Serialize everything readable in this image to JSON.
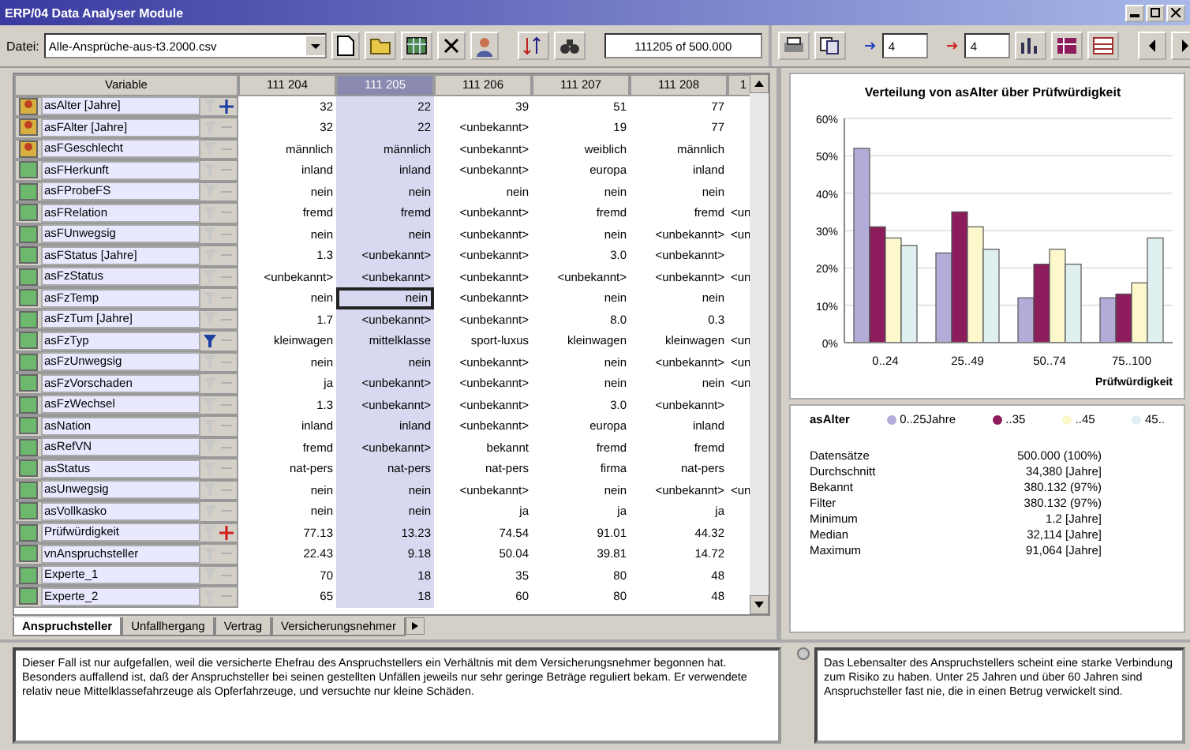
{
  "window": {
    "title": "ERP/04 Data Analyser Module"
  },
  "toolbar": {
    "file_label": "Datei:",
    "file": "Alle-Ansprüche-aus-t3.2000.csv",
    "counter": "111205 of 500.000",
    "blue_spin": "4",
    "red_spin": "4"
  },
  "table": {
    "name_header": "Variable",
    "columns": [
      {
        "label": "111 204",
        "selected": false
      },
      {
        "label": "111 205",
        "selected": true
      },
      {
        "label": "111 206",
        "selected": false
      },
      {
        "label": "111 207",
        "selected": false
      },
      {
        "label": "111 208",
        "selected": false
      },
      {
        "label": "1",
        "selected": false
      }
    ],
    "rows": [
      {
        "name": "asAlter [Jahre]",
        "kind": "person-plus",
        "focused": false,
        "cells": [
          "32",
          "22",
          "39",
          "51",
          "77"
        ]
      },
      {
        "name": "asFAlter [Jahre]",
        "kind": "person",
        "focused": false,
        "cells": [
          "32",
          "22",
          "<unbekannt>",
          "19",
          "77"
        ]
      },
      {
        "name": "asFGeschlecht",
        "kind": "person",
        "focused": false,
        "cells": [
          "männlich",
          "männlich",
          "<unbekannt>",
          "weiblich",
          "männlich"
        ]
      },
      {
        "name": "asFHerkunft",
        "kind": "field",
        "focused": false,
        "cells": [
          "inland",
          "inland",
          "<unbekannt>",
          "europa",
          "inland"
        ]
      },
      {
        "name": "asFProbeFS",
        "kind": "field",
        "focused": false,
        "cells": [
          "nein",
          "nein",
          "nein",
          "nein",
          "nein"
        ]
      },
      {
        "name": "asFRelation",
        "kind": "field",
        "focused": false,
        "cells": [
          "fremd",
          "fremd",
          "<unbekannt>",
          "fremd",
          "fremd",
          "<un"
        ]
      },
      {
        "name": "asFUnwegsig",
        "kind": "field",
        "focused": false,
        "cells": [
          "nein",
          "nein",
          "<unbekannt>",
          "nein",
          "<unbekannt>",
          "<un"
        ]
      },
      {
        "name": "asFStatus [Jahre]",
        "kind": "field",
        "focused": false,
        "cells": [
          "1.3",
          "<unbekannt>",
          "<unbekannt>",
          "3.0",
          "<unbekannt>"
        ]
      },
      {
        "name": "asFzStatus",
        "kind": "field",
        "focused": false,
        "cells": [
          "<unbekannt>",
          "<unbekannt>",
          "<unbekannt>",
          "<unbekannt>",
          "<unbekannt>",
          "<un"
        ]
      },
      {
        "name": "asFzTemp",
        "kind": "field",
        "focused": true,
        "cells": [
          "nein",
          "nein",
          "<unbekannt>",
          "nein",
          "nein"
        ]
      },
      {
        "name": "asFzTum [Jahre]",
        "kind": "field",
        "focused": false,
        "cells": [
          "1.7",
          "<unbekannt>",
          "<unbekannt>",
          "8.0",
          "0.3"
        ]
      },
      {
        "name": "asFzTyp",
        "kind": "field-filter",
        "focused": false,
        "cells": [
          "kleinwagen",
          "mittelklasse",
          "sport-luxus",
          "kleinwagen",
          "kleinwagen",
          "<un"
        ]
      },
      {
        "name": "asFzUnwegsig",
        "kind": "field",
        "focused": false,
        "cells": [
          "nein",
          "nein",
          "<unbekannt>",
          "nein",
          "<unbekannt>",
          "<un"
        ]
      },
      {
        "name": "asFzVorschaden",
        "kind": "field",
        "focused": false,
        "cells": [
          "ja",
          "<unbekannt>",
          "<unbekannt>",
          "nein",
          "nein",
          "<un"
        ]
      },
      {
        "name": "asFzWechsel",
        "kind": "field",
        "focused": false,
        "cells": [
          "1.3",
          "<unbekannt>",
          "<unbekannt>",
          "3.0",
          "<unbekannt>"
        ]
      },
      {
        "name": "asNation",
        "kind": "field",
        "focused": false,
        "cells": [
          "inland",
          "inland",
          "<unbekannt>",
          "europa",
          "inland"
        ]
      },
      {
        "name": "asRefVN",
        "kind": "field",
        "focused": false,
        "cells": [
          "fremd",
          "<unbekannt>",
          "bekannt",
          "fremd",
          "fremd"
        ]
      },
      {
        "name": "asStatus",
        "kind": "field",
        "focused": false,
        "cells": [
          "nat-pers",
          "nat-pers",
          "nat-pers",
          "firma",
          "nat-pers"
        ]
      },
      {
        "name": "asUnwegsig",
        "kind": "field",
        "focused": false,
        "cells": [
          "nein",
          "nein",
          "<unbekannt>",
          "nein",
          "<unbekannt>",
          "<un"
        ]
      },
      {
        "name": "asVollkasko",
        "kind": "field",
        "focused": false,
        "cells": [
          "nein",
          "nein",
          "ja",
          "ja",
          "ja"
        ]
      },
      {
        "name": "Prüfwürdigkeit",
        "kind": "field-flag",
        "focused": false,
        "cells": [
          "77.13",
          "13.23",
          "74.54",
          "91.01",
          "44.32"
        ]
      },
      {
        "name": "vnAnspruchsteller",
        "kind": "field",
        "focused": false,
        "cells": [
          "22.43",
          "9.18",
          "50.04",
          "39.81",
          "14.72"
        ]
      },
      {
        "name": "Experte_1",
        "kind": "field",
        "focused": false,
        "cells": [
          "70",
          "18",
          "35",
          "80",
          "48"
        ]
      },
      {
        "name": "Experte_2",
        "kind": "field",
        "focused": false,
        "cells": [
          "65",
          "18",
          "60",
          "80",
          "48"
        ]
      }
    ]
  },
  "sheet_tabs": [
    {
      "label": "Anspruchsteller",
      "selected": true
    },
    {
      "label": "Unfallhergang",
      "selected": false
    },
    {
      "label": "Vertrag",
      "selected": false
    },
    {
      "label": "Versicherungsnehmer",
      "selected": false
    }
  ],
  "chart": {
    "chart_data": {
      "type": "bar",
      "grid": true,
      "title": "Verteilung von asAlter über Prüfwürdigkeit",
      "xlabel": "Prüfwürdigkeit",
      "categories": [
        "0..24",
        "25..49",
        "50..74",
        "75..100"
      ],
      "ylim": [
        0,
        60
      ],
      "yticks": [
        {
          "value": 0,
          "label": "0%"
        },
        {
          "value": 10,
          "label": "10%"
        },
        {
          "value": 20,
          "label": "20%"
        },
        {
          "value": 30,
          "label": "30%"
        },
        {
          "value": 40,
          "label": "40%"
        },
        {
          "value": 50,
          "label": "50%"
        },
        {
          "value": 60,
          "label": "60%"
        }
      ],
      "series": [
        {
          "name": "0..25Jahre",
          "color": "#b4acd8",
          "values": [
            52,
            24,
            12,
            12
          ]
        },
        {
          "name": "..35",
          "color": "#8c1c5c",
          "values": [
            31,
            35,
            21,
            13
          ]
        },
        {
          "name": "..45",
          "color": "#fcf8cc",
          "values": [
            28,
            31,
            25,
            16
          ]
        },
        {
          "name": "45..",
          "color": "#e0f0f0",
          "values": [
            26,
            25,
            21,
            28
          ]
        }
      ]
    },
    "legend_title": "asAlter"
  },
  "stats": [
    {
      "label": "Datensätze",
      "value": "500.000 (100%)"
    },
    {
      "label": "Durchschnitt",
      "value": "34,380 [Jahre]"
    },
    {
      "label": "Bekannt",
      "value": "380.132 (97%)"
    },
    {
      "label": "Filter",
      "value": "380.132 (97%)"
    },
    {
      "label": "Minimum",
      "value": "1.2 [Jahre]"
    },
    {
      "label": "Median",
      "value": "32,114 [Jahre]"
    },
    {
      "label": "Maximum",
      "value": "91,064 [Jahre]"
    }
  ],
  "notes": {
    "case": "Dieser Fall ist nur aufgefallen, weil die versicherte Ehefrau des Anspruchstellers ein Verhältnis mit dem Versicherungsnehmer begonnen hat. Besonders auffallend ist, daß der Anspruchsteller bei seinen gestellten Unfällen jeweils nur sehr geringe Beträge reguliert bekam. Er verwendete relativ neue Mittelklassefahrzeuge als Opferfahrzeuge, und versuchte nur kleine Schäden.",
    "insight": "Das Lebensalter des Anspruchstellers scheint eine starke Verbindung zum Risiko zu haben. Unter 25 Jahren und über 60 Jahren sind Anspruchsteller fast nie, die in einen Betrug verwickelt sind."
  }
}
